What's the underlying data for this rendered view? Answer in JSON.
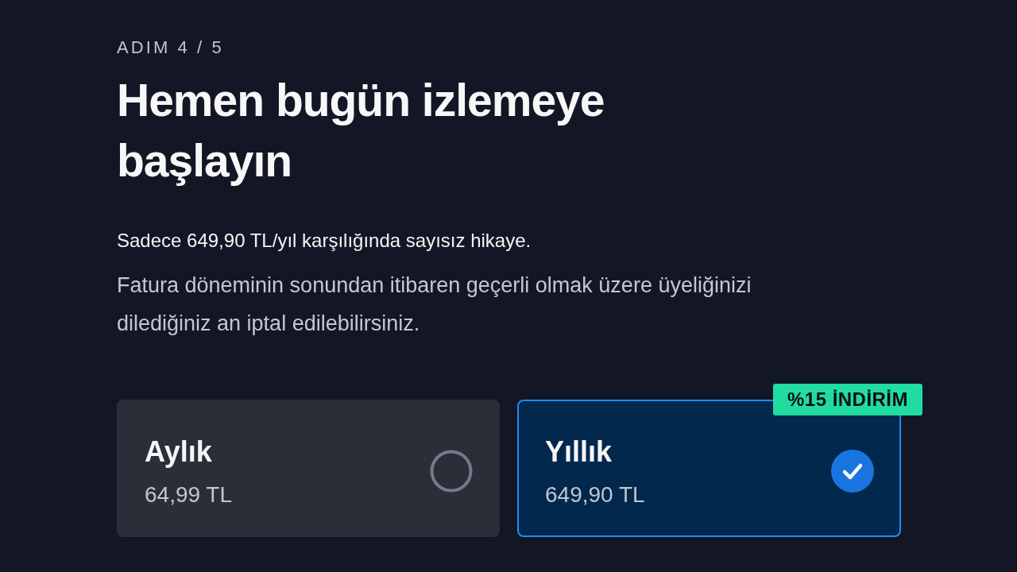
{
  "step": "ADIM 4 / 5",
  "title": "Hemen bugün izlemeye başlayın",
  "summary": "Sadece 649,90 TL/yıl karşılığında sayısız hikaye.",
  "note": "Fatura döneminin sonundan itibaren geçerli olmak üzere üyeliğinizi dilediğiniz an iptal edilebilirsiniz.",
  "plans": [
    {
      "name": "Aylık",
      "price": "64,99 TL",
      "selected": false
    },
    {
      "name": "Yıllık",
      "price": "649,90 TL",
      "selected": true,
      "badge": "%15 İNDİRİM"
    }
  ]
}
